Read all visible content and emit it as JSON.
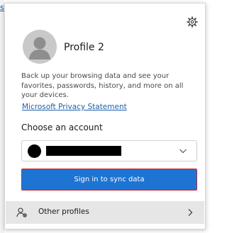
{
  "background": {
    "edge_link_text": "so"
  },
  "header": {
    "settings_icon": "gear-icon"
  },
  "profile": {
    "name": "Profile 2",
    "avatar_icon": "default-avatar-icon",
    "description": "Back up your browsing data and see your favorites, passwords, history, and more on all your devices.",
    "privacy_link": "Microsoft Privacy Statement"
  },
  "account": {
    "choose_label": "Choose an account",
    "selected_account_icon": "account-avatar-icon",
    "dropdown_icon": "chevron-down-icon"
  },
  "actions": {
    "sign_in_label": "Sign in to sync data"
  },
  "footer": {
    "other_profiles_label": "Other profiles",
    "other_profiles_icon": "profiles-icon",
    "chevron_icon": "chevron-right-icon"
  },
  "colors": {
    "accent": "#1d74d3",
    "link": "#1f5fa8",
    "focus_border": "#c0283a",
    "footer_bg": "#e6e6e6"
  }
}
